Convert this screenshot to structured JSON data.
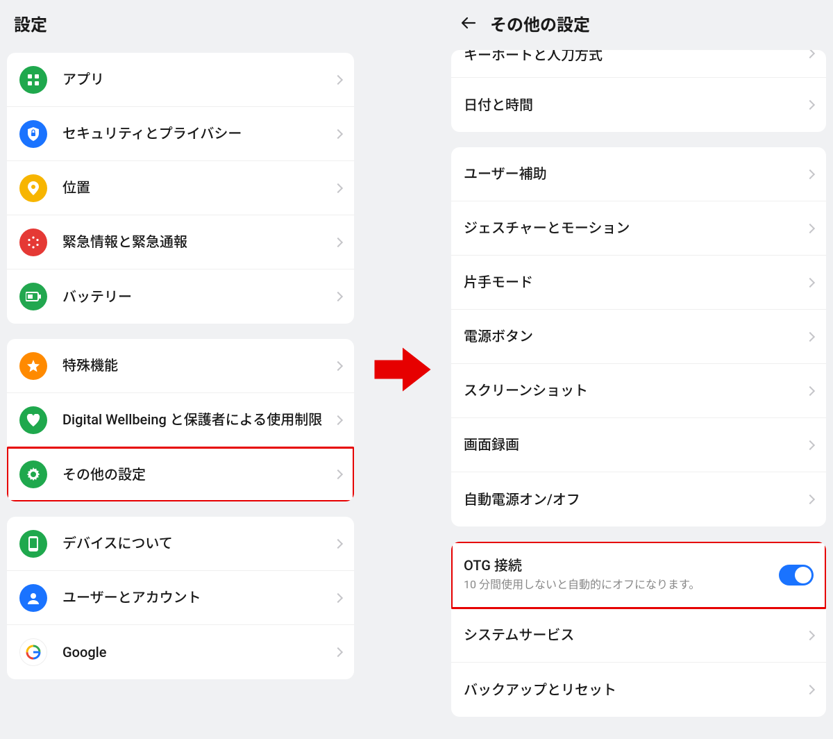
{
  "left": {
    "title": "設定",
    "group1": [
      {
        "label": "アプリ",
        "icon": {
          "name": "apps-icon",
          "bg": "#1fa84d"
        }
      },
      {
        "label": "セキュリティとプライバシー",
        "icon": {
          "name": "security-icon",
          "bg": "#1a73ff"
        }
      },
      {
        "label": "位置",
        "icon": {
          "name": "location-icon",
          "bg": "#f7b500"
        }
      },
      {
        "label": "緊急情報と緊急通報",
        "icon": {
          "name": "emergency-icon",
          "bg": "#e53935"
        }
      },
      {
        "label": "バッテリー",
        "icon": {
          "name": "battery-icon",
          "bg": "#22a74f"
        }
      }
    ],
    "group2": [
      {
        "label": "特殊機能",
        "icon": {
          "name": "special-icon",
          "bg": "#ff8a00"
        }
      },
      {
        "label": "Digital Wellbeing と保護者による使用制限",
        "icon": {
          "name": "wellbeing-icon",
          "bg": "#1fa84d"
        }
      },
      {
        "label": "その他の設定",
        "icon": {
          "name": "gear-icon",
          "bg": "#1fa84d"
        },
        "highlight": true
      }
    ],
    "group3": [
      {
        "label": "デバイスについて",
        "icon": {
          "name": "device-icon",
          "bg": "#1fa84d"
        }
      },
      {
        "label": "ユーザーとアカウント",
        "icon": {
          "name": "user-icon",
          "bg": "#1a73ff"
        }
      },
      {
        "label": "Google",
        "icon": {
          "name": "google-icon",
          "bg": "#ffffff"
        }
      }
    ]
  },
  "right": {
    "title": "その他の設定",
    "group0": [
      {
        "label": "キーホートと人刀方式"
      },
      {
        "label": "日付と時間"
      }
    ],
    "group1": [
      {
        "label": "ユーザー補助"
      },
      {
        "label": "ジェスチャーとモーション"
      },
      {
        "label": "片手モード"
      },
      {
        "label": "電源ボタン"
      },
      {
        "label": "スクリーンショット"
      },
      {
        "label": "画面録画"
      },
      {
        "label": "自動電源オン/オフ"
      }
    ],
    "group2": [
      {
        "label": "OTG 接続",
        "sub": "10 分間使用しないと自動的にオフになります。",
        "toggle": true,
        "highlight": true
      },
      {
        "label": "システムサービス"
      },
      {
        "label": "バックアップとリセット"
      }
    ]
  }
}
